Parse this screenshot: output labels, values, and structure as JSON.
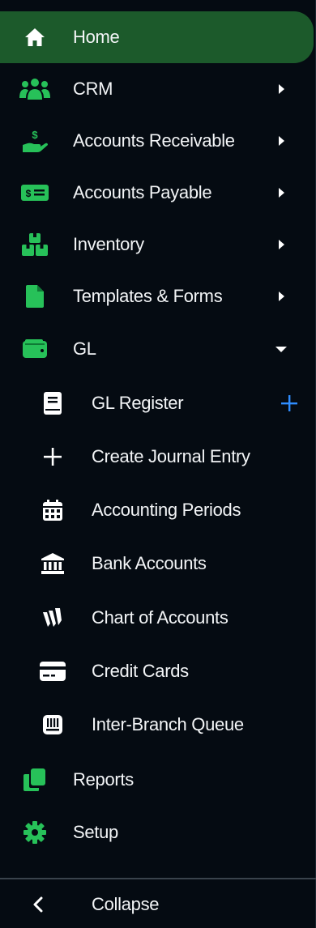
{
  "colors": {
    "background": "#050b12",
    "active_bg": "#1c5a2b",
    "accent_green": "#27c159",
    "accent_blue": "#2f8dff",
    "text": "#f3f5f7"
  },
  "nav": {
    "items": [
      {
        "label": "Home",
        "icon": "home-icon",
        "active": true
      },
      {
        "label": "CRM",
        "icon": "users-icon",
        "arrow": "right"
      },
      {
        "label": "Accounts Receivable",
        "icon": "hand-money-icon",
        "arrow": "right"
      },
      {
        "label": "Accounts Payable",
        "icon": "money-bill-icon",
        "arrow": "right"
      },
      {
        "label": "Inventory",
        "icon": "boxes-icon",
        "arrow": "right"
      },
      {
        "label": "Templates & Forms",
        "icon": "file-icon",
        "arrow": "right"
      },
      {
        "label": "GL",
        "icon": "wallet-icon",
        "arrow": "down",
        "expanded": true
      }
    ],
    "gl_submenu": [
      {
        "label": "GL Register",
        "icon": "book-icon",
        "add": "+"
      },
      {
        "label": "Create Journal Entry",
        "icon": "plus-icon"
      },
      {
        "label": "Accounting Periods",
        "icon": "calendar-icon"
      },
      {
        "label": "Bank Accounts",
        "icon": "bank-icon"
      },
      {
        "label": "Chart of Accounts",
        "icon": "chart-logo-icon"
      },
      {
        "label": "Credit Cards",
        "icon": "credit-card-icon"
      },
      {
        "label": "Inter-Branch Queue",
        "icon": "queue-icon"
      }
    ],
    "bottom_items": [
      {
        "label": "Reports",
        "icon": "copy-icon"
      },
      {
        "label": "Setup",
        "icon": "gear-icon"
      }
    ]
  },
  "footer": {
    "collapse_label": "Collapse",
    "icon": "chevron-left-icon"
  }
}
